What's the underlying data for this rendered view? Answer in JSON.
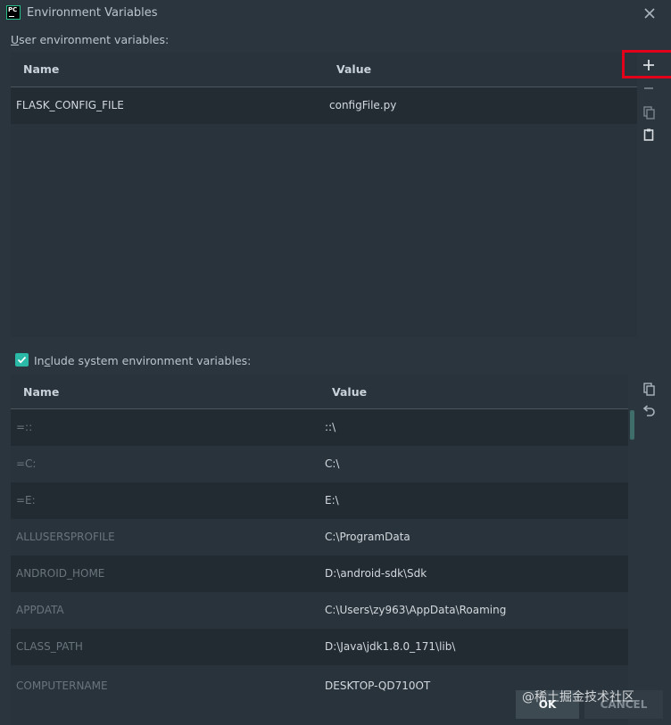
{
  "window": {
    "title": "Environment Variables",
    "close_icon": "close-icon"
  },
  "user_env": {
    "label_prefix": "U",
    "label_rest": "ser environment variables:",
    "columns": {
      "name": "Name",
      "value": "Value"
    },
    "rows": [
      {
        "name": "FLASK_CONFIG_FILE",
        "value": "configFile.py"
      }
    ],
    "toolbar": [
      "add-icon",
      "remove-icon",
      "copy-icon",
      "paste-icon"
    ]
  },
  "system_env": {
    "checkbox_checked": true,
    "label_prefix": "In",
    "label_mnemonic": "c",
    "label_rest": "lude system environment variables:",
    "columns": {
      "name": "Name",
      "value": "Value"
    },
    "rows": [
      {
        "name": "=::",
        "value": "::\\"
      },
      {
        "name": "=C:",
        "value": "C:\\"
      },
      {
        "name": "=E:",
        "value": "E:\\"
      },
      {
        "name": "ALLUSERSPROFILE",
        "value": "C:\\ProgramData"
      },
      {
        "name": "ANDROID_HOME",
        "value": "D:\\android-sdk\\Sdk"
      },
      {
        "name": "APPDATA",
        "value": "C:\\Users\\zy963\\AppData\\Roaming"
      },
      {
        "name": "CLASS_PATH",
        "value": "D:\\Java\\jdk1.8.0_171\\lib\\"
      },
      {
        "name": "COMPUTERNAME",
        "value": "DESKTOP-QD710OT"
      }
    ],
    "toolbar": [
      "copy-icon",
      "undo-icon"
    ]
  },
  "buttons": {
    "ok": "OK",
    "cancel": "CANCEL"
  },
  "watermark": "@稀土掘金技术社区",
  "colors": {
    "background": "#2b353d",
    "accent": "#2ab9a6",
    "highlight_box": "#e3001b"
  }
}
